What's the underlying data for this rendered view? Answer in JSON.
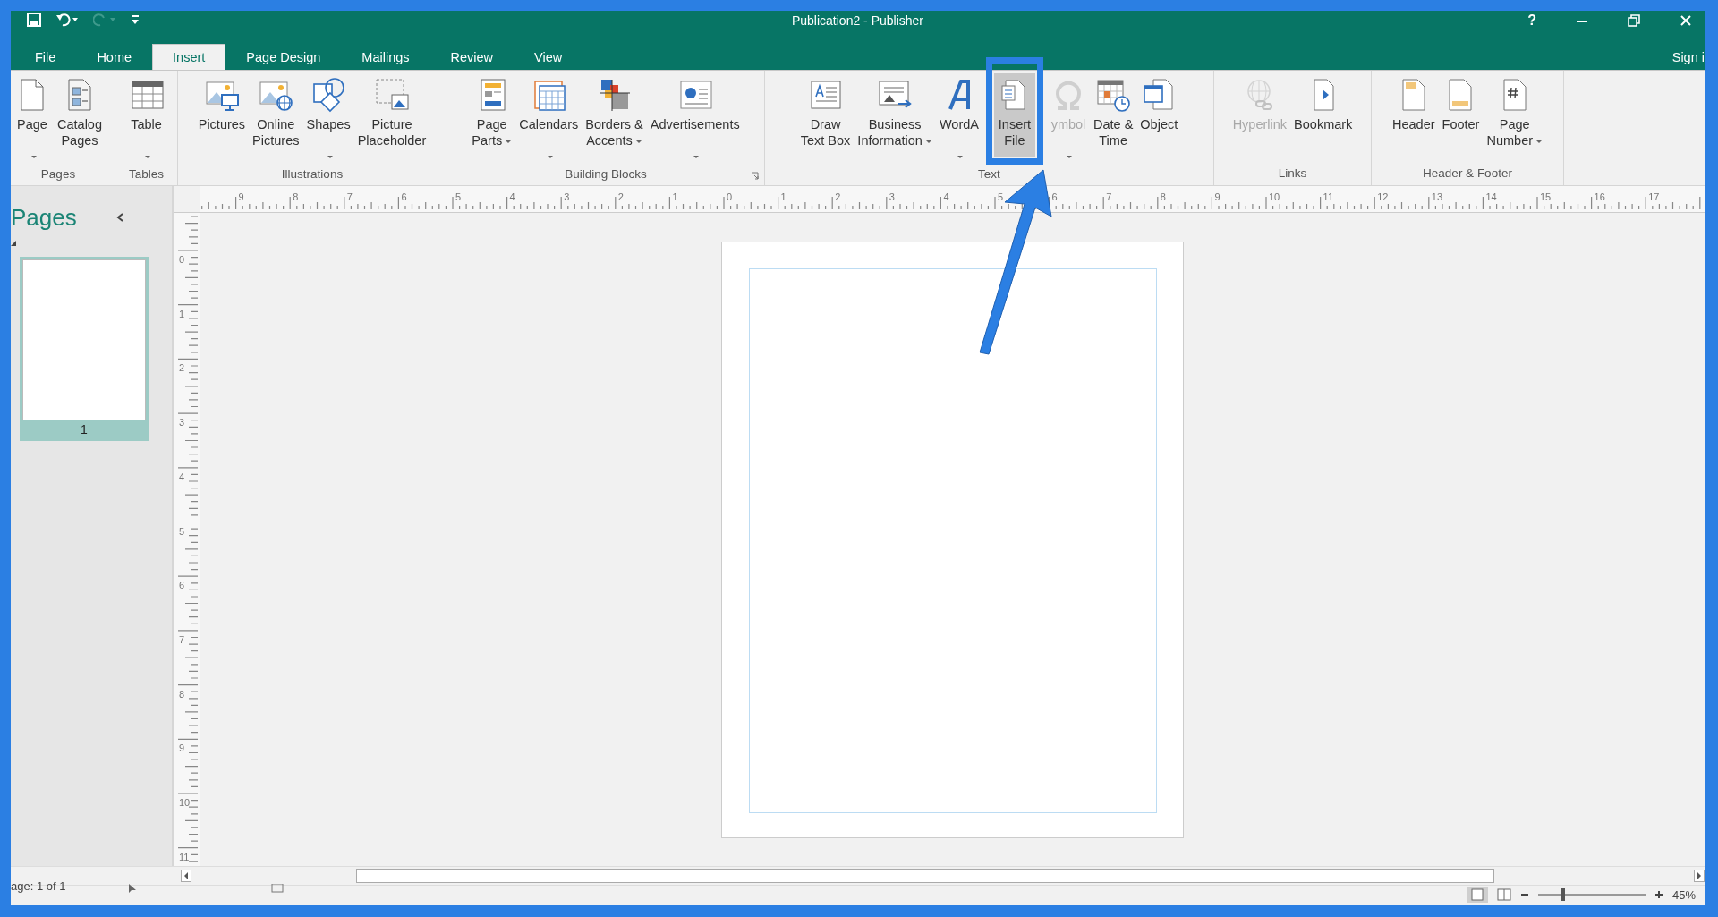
{
  "window": {
    "title": "Publication2 - Publisher",
    "help": "?"
  },
  "tabs": [
    {
      "label": "File",
      "selected": false
    },
    {
      "label": "Home",
      "selected": false
    },
    {
      "label": "Insert",
      "selected": true
    },
    {
      "label": "Page Design",
      "selected": false
    },
    {
      "label": "Mailings",
      "selected": false
    },
    {
      "label": "Review",
      "selected": false
    },
    {
      "label": "View",
      "selected": false
    }
  ],
  "sign_in": "Sign i",
  "ribbon": [
    {
      "name": "Pages",
      "launcher": false,
      "buttons": [
        {
          "label": "Page",
          "dropdown": true,
          "disabled": false,
          "selected": false
        },
        {
          "label": "Catalog\nPages",
          "dropdown": false,
          "disabled": false,
          "selected": false
        }
      ]
    },
    {
      "name": "Tables",
      "launcher": false,
      "buttons": [
        {
          "label": "Table",
          "dropdown": true,
          "disabled": false,
          "selected": false
        }
      ]
    },
    {
      "name": "Illustrations",
      "launcher": false,
      "buttons": [
        {
          "label": "Pictures",
          "dropdown": false,
          "disabled": false,
          "selected": false
        },
        {
          "label": "Online\nPictures",
          "dropdown": false,
          "disabled": false,
          "selected": false
        },
        {
          "label": "Shapes",
          "dropdown": true,
          "disabled": false,
          "selected": false
        },
        {
          "label": "Picture\nPlaceholder",
          "dropdown": false,
          "disabled": false,
          "selected": false
        }
      ]
    },
    {
      "name": "Building Blocks",
      "launcher": true,
      "buttons": [
        {
          "label": "Page\nParts",
          "dropdown": true,
          "disabled": false,
          "selected": false
        },
        {
          "label": "Calendars",
          "dropdown": true,
          "disabled": false,
          "selected": false
        },
        {
          "label": "Borders &\nAccents",
          "dropdown": true,
          "disabled": false,
          "selected": false
        },
        {
          "label": "Advertisements",
          "dropdown": true,
          "disabled": false,
          "selected": false
        }
      ]
    },
    {
      "name": "Text",
      "launcher": false,
      "buttons": [
        {
          "label": "Draw\nText Box",
          "dropdown": false,
          "disabled": false,
          "selected": false
        },
        {
          "label": "Business\nInformation",
          "dropdown": true,
          "disabled": false,
          "selected": false
        },
        {
          "label": "WordA",
          "dropdown": true,
          "disabled": false,
          "selected": false
        },
        {
          "label": "Insert\nFile",
          "dropdown": false,
          "disabled": false,
          "selected": true
        },
        {
          "label": "ymbol",
          "dropdown": true,
          "disabled": true,
          "selected": false
        },
        {
          "label": "Date &\nTime",
          "dropdown": false,
          "disabled": false,
          "selected": false
        },
        {
          "label": "Object",
          "dropdown": false,
          "disabled": false,
          "selected": false
        }
      ]
    },
    {
      "name": "Links",
      "launcher": false,
      "buttons": [
        {
          "label": "Hyperlink",
          "dropdown": false,
          "disabled": true,
          "selected": false
        },
        {
          "label": "Bookmark",
          "dropdown": false,
          "disabled": false,
          "selected": false
        }
      ]
    },
    {
      "name": "Header & Footer",
      "launcher": false,
      "buttons": [
        {
          "label": "Header",
          "dropdown": false,
          "disabled": false,
          "selected": false
        },
        {
          "label": "Footer",
          "dropdown": false,
          "disabled": false,
          "selected": false
        },
        {
          "label": "Page\nNumber",
          "dropdown": true,
          "disabled": false,
          "selected": false
        }
      ]
    }
  ],
  "pages_pane": {
    "title": "Pages",
    "thumbnails": [
      {
        "label": "1",
        "selected": true
      }
    ]
  },
  "ruler": {
    "horizontal": [
      "9",
      "8",
      "7",
      "6",
      "5",
      "4",
      "3",
      "2",
      "1",
      "0",
      "1",
      "2",
      "3",
      "4",
      "5",
      "6",
      "7",
      "8",
      "9",
      "10",
      "11",
      "12",
      "13",
      "14",
      "15",
      "16",
      "17"
    ],
    "vertical": [
      "0",
      "1",
      "2",
      "3",
      "4",
      "5",
      "6",
      "7",
      "8",
      "9",
      "10",
      "11"
    ]
  },
  "status_bar": {
    "page": "age: 1 of 1",
    "zoom": "45%",
    "zoom_slider": {
      "level": 0.23
    }
  }
}
